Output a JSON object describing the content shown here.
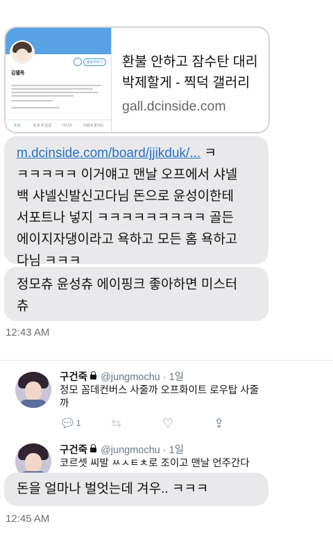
{
  "link_preview": {
    "title_line1": "환불 안하고 잠수탄 대리",
    "title_line2": "박제할게 - 찍덕 갤러리",
    "domain": "gall.dcinside.com",
    "thumbnail": {
      "profile_name": "김델목",
      "follow_label": "팔로우하기",
      "tabs": [
        "트윗",
        "트윗 및 답글",
        "미디어",
        "마음에 들어요"
      ]
    }
  },
  "messages": [
    {
      "link_text": "m.dcinside.com/board/jjikduk/...",
      "lines": [
        " ㅋ",
        "ㅋㅋㅋㅋㅋ 이거얘고 맨날 오프에서 샤넬",
        "백 샤넬신발신고다님 돈으로 윤성이한테",
        "서포트나 넣지  ㅋㅋㅋㅋㅋㅋㅋㅋㅋ 골든",
        "에이지자댕이라고 욕하고 모든 홈 욕하고",
        "다님 ㅋㅋㅋ"
      ]
    },
    {
      "lines": [
        "정모츄 윤성츄 에이핑크 좋아하면 미스터",
        "츄"
      ]
    },
    {
      "lines": [
        "돈을 얼마나 벌엇는데 겨우.. ㅋㅋㅋ"
      ]
    }
  ],
  "timestamps": [
    "12:43 AM",
    "12:45 AM"
  ],
  "tweets": [
    {
      "name": "구건죽",
      "handle": "@jungmochu",
      "time": "1일",
      "text_line1": "정모 꼼데컨버스 사줄까 오프화이트 로우탑 사줄",
      "text_line2": "까",
      "reply_count": "1"
    },
    {
      "name": "구건죽",
      "handle": "@jungmochu",
      "time": "1일",
      "text_line1": "코르셋 씨발 ㅆㅅㅌㅊ로 조이고 맨날 언주간다"
    }
  ]
}
